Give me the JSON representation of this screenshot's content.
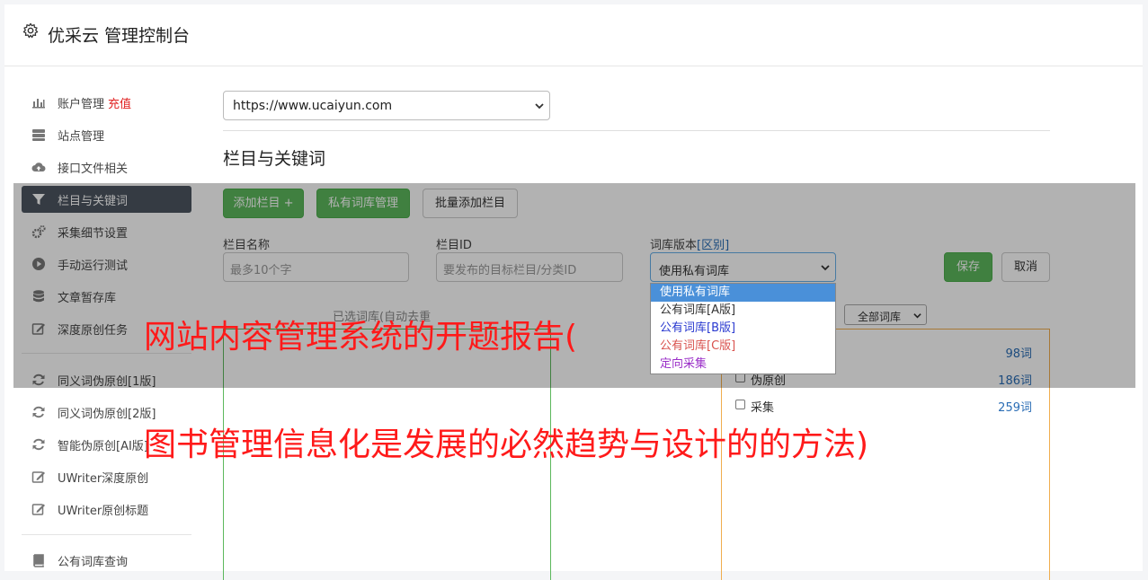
{
  "header": {
    "title": "优采云 管理控制台"
  },
  "sidebar": {
    "items": [
      {
        "label": "账户管理",
        "extra": "充值",
        "icon": "bar-chart-icon"
      },
      {
        "label": "站点管理",
        "icon": "server-icon"
      },
      {
        "label": "接口文件相关",
        "icon": "cloud-upload-icon"
      },
      {
        "label": "栏目与关键词",
        "icon": "filter-icon",
        "active": true
      },
      {
        "label": "采集细节设置",
        "icon": "cogs-icon"
      },
      {
        "label": "手动运行测试",
        "icon": "play-circle-icon"
      },
      {
        "label": "文章暂存库",
        "icon": "database-icon"
      },
      {
        "label": "深度原创任务",
        "icon": "edit-icon"
      },
      {
        "label": "同义词伪原创[1版]",
        "icon": "refresh-icon"
      },
      {
        "label": "同义词伪原创[2版]",
        "icon": "refresh-icon"
      },
      {
        "label": "智能伪原创[AI版]",
        "icon": "refresh-icon"
      },
      {
        "label": "UWriter深度原创",
        "icon": "edit-icon"
      },
      {
        "label": "UWriter原创标题",
        "icon": "edit-icon"
      },
      {
        "label": "公有词库查询",
        "icon": "book-icon"
      }
    ]
  },
  "site_select": {
    "value": "https://www.ucaiyun.com"
  },
  "section": {
    "title": "栏目与关键词"
  },
  "toolbar": {
    "add_label": "添加栏目 +",
    "private_label": "私有词库管理",
    "batch_label": "批量添加栏目"
  },
  "form": {
    "name_label": "栏目名称",
    "name_placeholder": "最多10个字",
    "id_label": "栏目ID",
    "id_placeholder": "要发布的目标栏目/分类ID",
    "version_label": "词库版本",
    "version_link": "[区别]",
    "version_value": "使用私有词库",
    "save_label": "保存",
    "cancel_label": "取消"
  },
  "dropdown": {
    "options": [
      {
        "label": "使用私有词库",
        "color": "#ffffff"
      },
      {
        "label": "公有词库[A版]",
        "color": "#333333"
      },
      {
        "label": "公有词库[B版]",
        "color": "#2a3ad0"
      },
      {
        "label": "公有词库[C版]",
        "color": "#d9534f"
      },
      {
        "label": "定向采集",
        "color": "#9b30c8"
      }
    ]
  },
  "hint": "已选词库(自动去重",
  "filter_select": {
    "value": "全部词库"
  },
  "libraries": [
    {
      "name": "",
      "count": "98词"
    },
    {
      "name": "伪原创",
      "count": "186词"
    },
    {
      "name": "采集",
      "count": "259词"
    }
  ],
  "watermark": {
    "line1": "网站内容管理系统的开题报告(",
    "line2": "图书管理信息化是发展的必然趋势与设计的的方法)"
  }
}
